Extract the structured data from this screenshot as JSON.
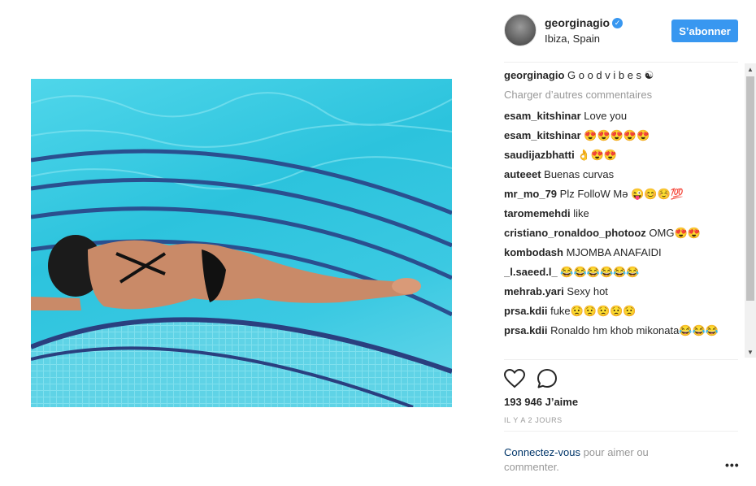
{
  "post": {
    "username": "georginagio",
    "verified_glyph": "✓",
    "location": "Ibiza, Spain",
    "follow_label": "S’abonner",
    "image_alt": "Woman lying by pool",
    "caption": {
      "user": "georginagio",
      "text": "G o o d v i b e s ☯"
    },
    "load_more": "Charger d’autres commentaires",
    "comments": [
      {
        "user": "esam_kitshinar",
        "text": "Love you"
      },
      {
        "user": "esam_kitshinar",
        "text": "😍😍😍😍😍"
      },
      {
        "user": "saudijazbhatti",
        "text": "👌😍😍"
      },
      {
        "user": "auteeet",
        "text": "Buenas curvas"
      },
      {
        "user": "mr_mo_79",
        "text": "Plz FolloW Mə 😜😊☺️💯"
      },
      {
        "user": "taromemehdi",
        "text": "like"
      },
      {
        "user": "cristiano_ronaldoo_photooz",
        "text": "OMG😍😍"
      },
      {
        "user": "kombodash",
        "text": "MJOMBA ANAFAIDI"
      },
      {
        "user": "_l.saeed.l_",
        "text": "😂😂😂😂😂😂"
      },
      {
        "user": "mehrab.yari",
        "text": "Sexy hot"
      },
      {
        "user": "prsa.kdii",
        "text": "fuke😟😟😟😟😟"
      },
      {
        "user": "prsa.kdii",
        "text": "Ronaldo hm khob mikonata😂😂😂"
      }
    ],
    "likes": "193 946 J’aime",
    "time": "IL Y A 2 JOURS",
    "login_link": "Connectez-vous",
    "login_text": " pour aimer ou commenter.",
    "more_glyph": "•••",
    "icons": {
      "like": "heart-icon",
      "comment": "comment-icon"
    },
    "colors": {
      "accent": "#3897f0",
      "link": "#003569",
      "muted": "#999999"
    }
  }
}
